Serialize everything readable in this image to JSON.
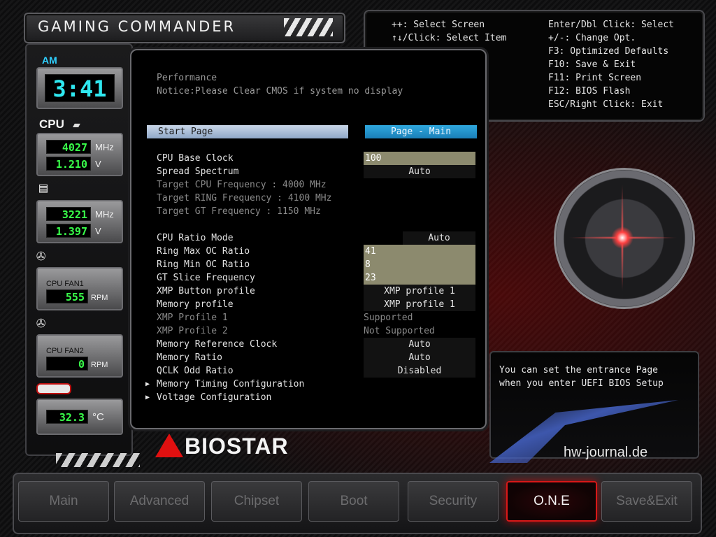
{
  "header": {
    "title": "GAMING COMMANDER"
  },
  "help": {
    "select_screen": "++: Select Screen",
    "select_item": "↑↓/Click: Select Item",
    "enter": "Enter/Dbl Click: Select",
    "change": "+/-: Change Opt.",
    "f3": "F3: Optimized Defaults",
    "f10": "F10: Save & Exit",
    "f11": "F11: Print Screen",
    "f12": "F12: BIOS Flash",
    "esc": "ESC/Right Click: Exit"
  },
  "sidebar": {
    "ampm": "AM",
    "clock": "3:41",
    "cpu_label": "CPU",
    "cpu_freq": "4027",
    "cpu_freq_unit": "MHz",
    "cpu_volt": "1.210",
    "cpu_volt_unit": "V",
    "mem_freq": "3221",
    "mem_freq_unit": "MHz",
    "mem_volt": "1.397",
    "mem_volt_unit": "V",
    "fan1_label": "CPU FAN1",
    "fan1_rpm": "555",
    "fan1_unit": "RPM",
    "fan2_label": "CPU FAN2",
    "fan2_rpm": "0",
    "fan2_unit": "RPM",
    "temp": "32.3",
    "temp_unit": "°C"
  },
  "main": {
    "section": "Performance",
    "notice": "Notice:Please Clear CMOS if system no display",
    "header_label": "Start Page",
    "header_value": "Page - Main",
    "rows": [
      {
        "label": "CPU Base Clock",
        "value": "100"
      },
      {
        "label": "Spread Spectrum",
        "value": "Auto"
      },
      {
        "label": "Target CPU Frequency : 4000 MHz"
      },
      {
        "label": "Target RING Frequency : 4100 MHz"
      },
      {
        "label": "Target GT Frequency : 1150 MHz"
      },
      {
        "label": "CPU Ratio Mode",
        "value": "Auto"
      },
      {
        "label": "Ring Max OC Ratio",
        "value": "41"
      },
      {
        "label": "Ring Min OC Ratio",
        "value": "8"
      },
      {
        "label": "GT Slice Frequency",
        "value": "23"
      },
      {
        "label": "XMP Button profile",
        "value": "XMP profile 1"
      },
      {
        "label": "Memory profile",
        "value": "XMP profile 1"
      },
      {
        "label": "XMP Profile 1",
        "value": "Supported"
      },
      {
        "label": "XMP Profile 2",
        "value": "Not Supported"
      },
      {
        "label": "Memory Reference Clock",
        "value": "Auto"
      },
      {
        "label": "Memory Ratio",
        "value": "Auto"
      },
      {
        "label": "QCLK Odd Ratio",
        "value": "Disabled"
      },
      {
        "label": "Memory Timing Configuration"
      },
      {
        "label": "Voltage Configuration"
      }
    ]
  },
  "description": {
    "line1": "You can set the entrance Page",
    "line2": "when you enter UEFI BIOS Setup"
  },
  "brand": {
    "logo": "BIOSTAR",
    "watermark": "hw-journal.de"
  },
  "tabs": [
    "Main",
    "Advanced",
    "Chipset",
    "Boot",
    "Security",
    "O.N.E",
    "Save&Exit"
  ],
  "active_tab": "O.N.E"
}
